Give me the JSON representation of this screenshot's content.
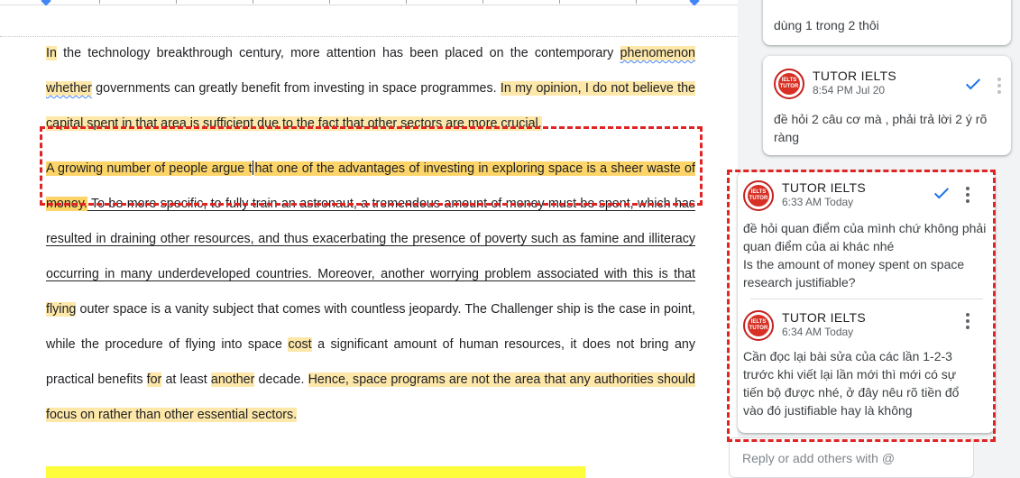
{
  "document": {
    "para1": {
      "s1": "In",
      "s2": " the technology breakthrough century, more attention has been placed on the contemporary ",
      "s3": "phenomenon",
      "s4": "whether",
      "s5": " governments can greatly benefit from investing in space programmes. ",
      "s6": "In my opinion, I do not believe the capital spent in that area is sufficient due to the fact that other sectors are more crucial."
    },
    "para2": {
      "s1": "A growing number of people argue t",
      "s2": "hat one of the advantages of investing in exploring space is a sheer waste of money.",
      "s3": " To be more specific, to fully train an astronaut, a tremendous amount of money must be spent, which has resulted in draining other resources, and thus exacerbating the presence of poverty such as famine and illiteracy occurring in many underdeveloped countries. Moreover, another worrying problem associated with this is that ",
      "s4": "flying",
      "s5": " outer space is a vanity subject that comes with countless jeopardy. The Challenger ship is the case in point, while the procedure of flying into space ",
      "s6": "cost",
      "s7": " a significant amount of human resources, it does not bring any practical benefits ",
      "s8": "for",
      "s9": " at least ",
      "s10": "another",
      "s11": " decade. ",
      "s12": "Hence, space programs are not the area that any authorities should focus on rather than other essential sectors."
    }
  },
  "comments": {
    "top_partial": {
      "text": "dùng 1 trong 2 thôi"
    },
    "mid": {
      "author": "TUTOR IELTS",
      "time": "8:54 PM Jul 20",
      "text": "đề hỏi 2 câu cơ mà , phải trả lời 2 ý rõ ràng"
    },
    "thread": [
      {
        "author": "TUTOR IELTS",
        "time": "6:33 AM Today",
        "text_line1": "đề hỏi quan điểm của mình chứ không phải quan điểm của ai khác nhé",
        "text_line2": "Is the amount of money spent on space research justifiable?"
      },
      {
        "author": "TUTOR IELTS",
        "time": "6:34 AM Today",
        "text": "Cần đọc lại bài sửa của các lần 1-2-3 trước khi viết lại lần mới thì mới có sự tiến bộ được nhé, ở đây nêu rõ tiền đổ vào đó justifiable hay là không"
      }
    ],
    "reply_placeholder": "Reply or add others with @"
  },
  "avatar_label": {
    "line1": "IELTS",
    "line2": "TUTOR"
  },
  "icons": {
    "resolve": "check-icon",
    "more": "more-vert-icon",
    "avatar": "tutor-ielts-logo"
  },
  "colors": {
    "highlight": "#fde7a9",
    "highlight_strong": "#fcd468",
    "annotation_red": "#e02424",
    "resolve_blue": "#1a73e8",
    "spellcheck_blue": "#4285f4"
  }
}
